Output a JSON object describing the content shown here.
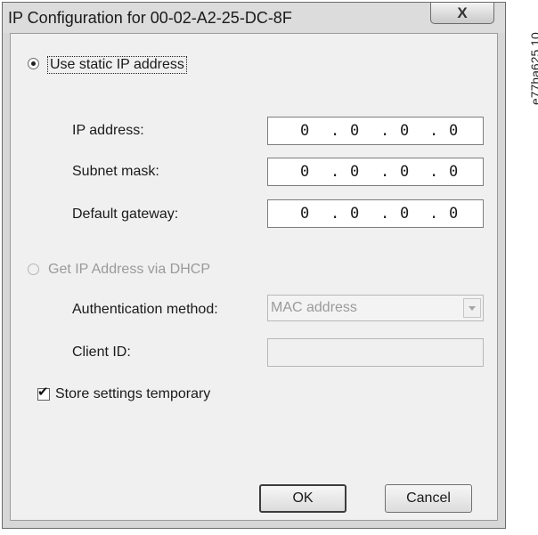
{
  "window": {
    "title": "IP Configuration for  00-02-A2-25-DC-8F",
    "close_label": "X"
  },
  "static": {
    "radio_label": "Use static IP address",
    "selected": true,
    "fields": [
      {
        "label": "IP address:",
        "octets": [
          "0",
          "0",
          "0",
          "0"
        ]
      },
      {
        "label": "Subnet mask:",
        "octets": [
          "0",
          "0",
          "0",
          "0"
        ]
      },
      {
        "label": "Default gateway:",
        "octets": [
          "0",
          "0",
          "0",
          "0"
        ]
      }
    ]
  },
  "dhcp": {
    "radio_label": "Get IP Address via DHCP",
    "selected": false,
    "auth_label": "Authentication method:",
    "auth_value": "MAC address",
    "client_label": "Client ID:",
    "client_value": ""
  },
  "store": {
    "label": "Store settings temporary",
    "checked": true
  },
  "buttons": {
    "ok": "OK",
    "cancel": "Cancel"
  },
  "figure_code": "e77ha625.10",
  "icons": [
    "close-icon",
    "dropdown-arrow-icon",
    "checkmark-icon"
  ]
}
